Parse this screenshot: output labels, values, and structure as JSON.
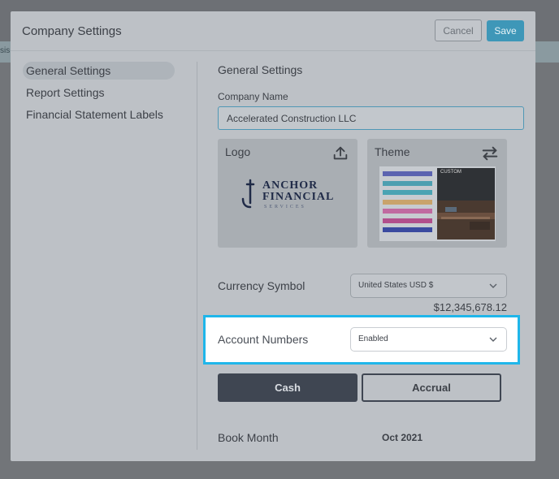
{
  "backdrop": {
    "strip_text": "sis"
  },
  "modal": {
    "title": "Company Settings",
    "cancel_label": "Cancel",
    "save_label": "Save"
  },
  "sidebar": {
    "items": [
      {
        "label": "General Settings",
        "active": true
      },
      {
        "label": "Report Settings",
        "active": false
      },
      {
        "label": "Financial Statement Labels",
        "active": false
      }
    ]
  },
  "general": {
    "section_title": "General Settings",
    "company_name_label": "Company Name",
    "company_name_value": "Accelerated Construction LLC",
    "logo_card": {
      "title": "Logo",
      "icon": "upload-icon",
      "logo_text_line1": "ANCHOR",
      "logo_text_line2": "FINANCIAL",
      "logo_text_line3": "SERVICES"
    },
    "theme_card": {
      "title": "Theme",
      "icon": "swap-arrows-icon",
      "preview_tag": "CUSTOM",
      "stripe_colors": [
        "#5b63b0",
        "#4d9fb0",
        "#4aa3b3",
        "#c9a36b",
        "#c06aa0",
        "#b14f8c",
        "#3a4aa0"
      ]
    },
    "currency": {
      "label": "Currency Symbol",
      "selected": "United States USD $",
      "preview": "$12,345,678.12"
    },
    "account_numbers": {
      "label": "Account Numbers",
      "selected": "Enabled"
    },
    "accounting_basis": {
      "cash_label": "Cash",
      "accrual_label": "Accrual",
      "selected": "Cash"
    },
    "book_month": {
      "label": "Book Month",
      "value": "Oct 2021"
    }
  },
  "colors": {
    "accent": "#3e97b8",
    "highlight": "#1fb6ea",
    "dark_button": "#3f4652"
  }
}
